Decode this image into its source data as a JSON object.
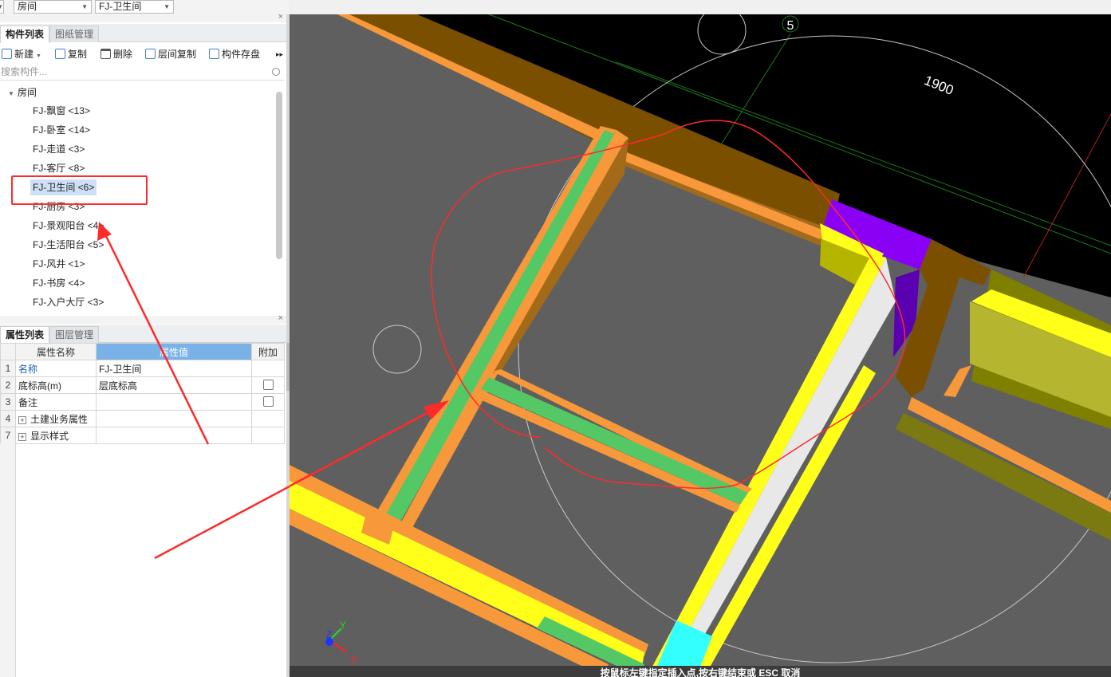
{
  "top_selectors": {
    "category": "房间",
    "component": "FJ-卫生间"
  },
  "component_panel": {
    "tabs": [
      "构件列表",
      "图纸管理"
    ],
    "toolbar": {
      "new": "新建",
      "copy": "复制",
      "delete": "删除",
      "floor_copy": "层间复制",
      "save": "构件存盘"
    },
    "search_placeholder": "搜索构件...",
    "tree_root": "房间",
    "items": [
      "FJ-飘窗 <13>",
      "FJ-卧室 <14>",
      "FJ-走道 <3>",
      "FJ-客厅 <8>",
      "FJ-卫生间 <6>",
      "FJ-厨房 <3>",
      "FJ-景观阳台 <4>",
      "FJ-生活阳台 <5>",
      "FJ-风井 <1>",
      "FJ-书房 <4>",
      "FJ-入户大厅 <3>"
    ],
    "selected_index": 4
  },
  "property_panel": {
    "tabs": [
      "属性列表",
      "图层管理"
    ],
    "headers": [
      "属性名称",
      "属性值",
      "附加"
    ],
    "rows": [
      {
        "num": "1",
        "name": "名称",
        "value": "FJ-卫生间"
      },
      {
        "num": "2",
        "name": "底标高(m)",
        "value": "层底标高"
      },
      {
        "num": "3",
        "name": "备注",
        "value": ""
      },
      {
        "num": "4",
        "name": "土建业务属性",
        "value": ""
      },
      {
        "num": "7",
        "name": "显示样式",
        "value": ""
      }
    ]
  },
  "viewport": {
    "axis_label": "5",
    "dimension": "1900",
    "axes": {
      "x": "X",
      "y": "Y",
      "z": "Z"
    },
    "status_text": "按鼠标左键指定插入点,按右键结束或 ESC 取消"
  },
  "colors": {
    "floor": "#5f5f5f",
    "background": "#000000",
    "wall_orange": "#f7983a",
    "wall_green": "#55c866",
    "wall_yellow": "#ffff1a",
    "wall_brown": "#7a5000",
    "purple": "#8a00f5",
    "cyan": "#33ffff",
    "annotation_red": "#ff2a2a",
    "selection": "#cfe0f6"
  }
}
